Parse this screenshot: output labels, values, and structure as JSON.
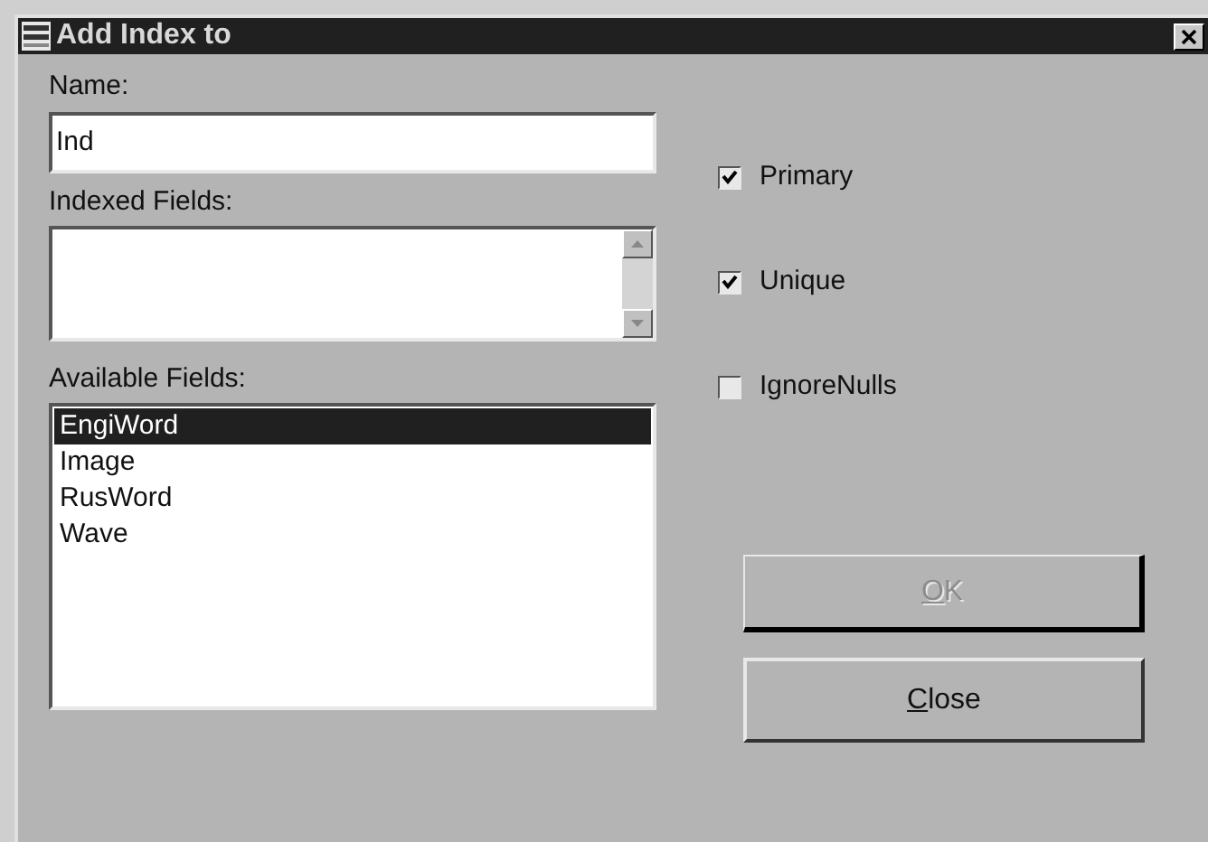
{
  "window": {
    "title": "Add Index to"
  },
  "name_field": {
    "label": "Name:",
    "value": "Ind"
  },
  "indexed_fields": {
    "label": "Indexed Fields:"
  },
  "available_fields": {
    "label": "Available Fields:",
    "items": [
      {
        "label": "EngiWord",
        "selected": true
      },
      {
        "label": "Image",
        "selected": false
      },
      {
        "label": "RusWord",
        "selected": false
      },
      {
        "label": "Wave",
        "selected": false
      }
    ]
  },
  "options": [
    {
      "label": "Primary",
      "checked": true
    },
    {
      "label": "Unique",
      "checked": true
    },
    {
      "label": "IgnoreNulls",
      "checked": false
    }
  ],
  "buttons": [
    {
      "mnemonic": "O",
      "label_rest": "K",
      "disabled": true,
      "default": true
    },
    {
      "mnemonic": "C",
      "label_rest": "lose",
      "disabled": false,
      "default": false
    }
  ]
}
